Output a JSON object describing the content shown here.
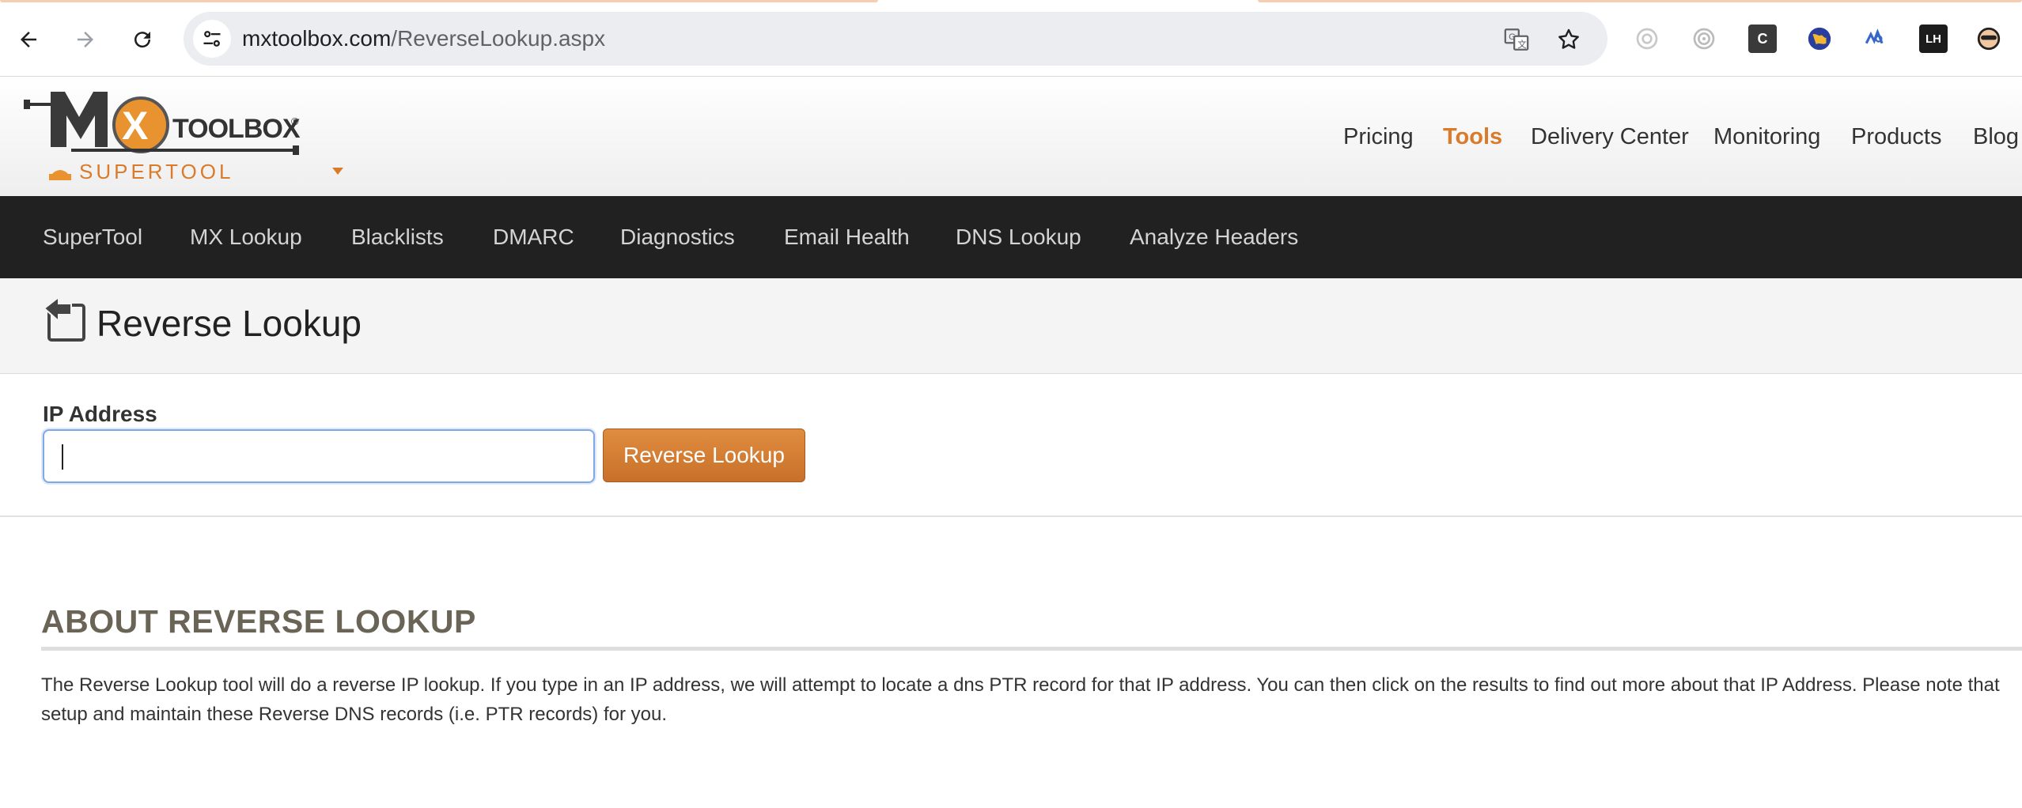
{
  "browser": {
    "url_host": "mxtoolbox.com",
    "url_path": "/ReverseLookup.aspx",
    "extensions": [
      {
        "icon": "gear-ext-icon"
      },
      {
        "icon": "target-ext-icon"
      },
      {
        "icon": "c-ext-icon",
        "label": "C"
      },
      {
        "icon": "globe-ext-icon"
      },
      {
        "icon": "wave-ext-icon"
      },
      {
        "icon": "lh-ext-icon",
        "label": "LH"
      },
      {
        "icon": "spy-ext-icon"
      }
    ]
  },
  "header": {
    "logo_text": "TOOLBOX",
    "logo_sub": "SUPERTOOL",
    "nav": [
      {
        "label": "Pricing",
        "active": false
      },
      {
        "label": "Tools",
        "active": true
      },
      {
        "label": "Delivery Center",
        "active": false
      },
      {
        "label": "Monitoring",
        "active": false
      },
      {
        "label": "Products",
        "active": false
      },
      {
        "label": "Blog",
        "active": false
      }
    ]
  },
  "subnav": {
    "items": [
      "SuperTool",
      "MX Lookup",
      "Blacklists",
      "DMARC",
      "Diagnostics",
      "Email Health",
      "DNS Lookup",
      "Analyze Headers"
    ]
  },
  "page": {
    "title": "Reverse Lookup"
  },
  "form": {
    "label": "IP Address",
    "value": "",
    "button_label": "Reverse Lookup"
  },
  "about": {
    "heading": "ABOUT REVERSE LOOKUP",
    "text": "The Reverse Lookup tool will do a reverse IP lookup. If you type in an IP address, we will attempt to locate a dns PTR record for that IP address. You can then click on the results to find out more about that IP Address. Please note that setup and maintain these Reverse DNS records (i.e. PTR records) for you."
  },
  "colors": {
    "accent": "#d97b2b",
    "dark_nav": "#212121",
    "button": "#d4803a"
  }
}
